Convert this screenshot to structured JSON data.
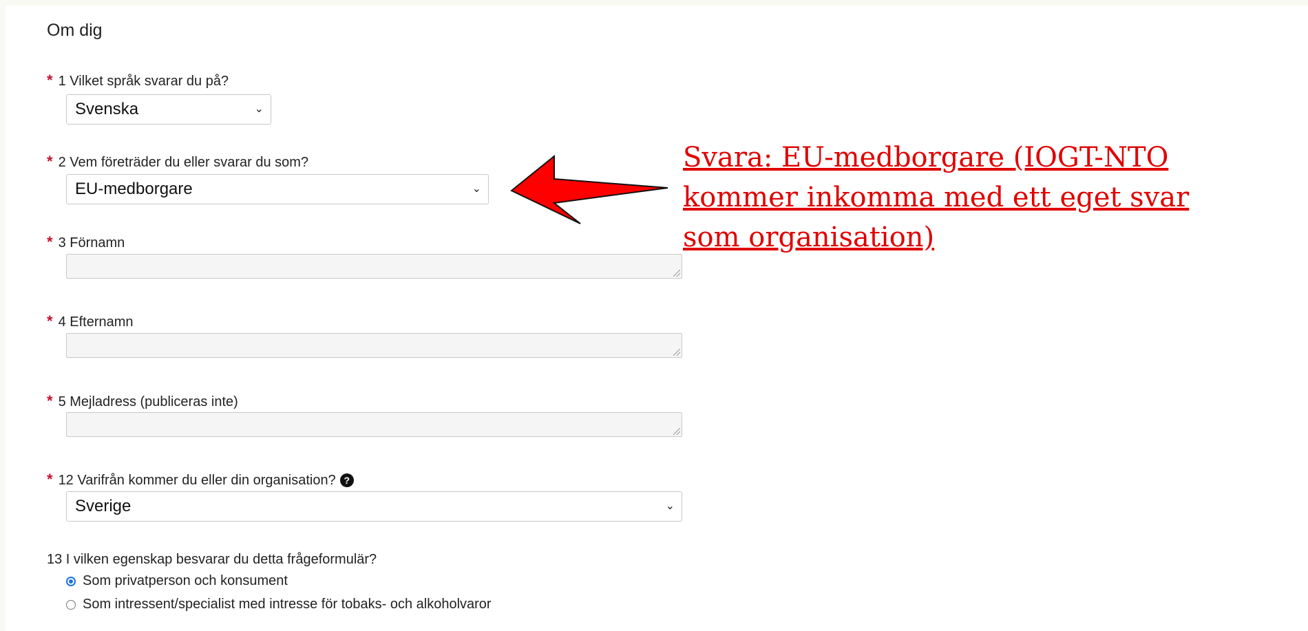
{
  "section": {
    "title": "Om dig"
  },
  "q1": {
    "required": "*",
    "label": "1 Vilket språk svarar du på?",
    "value": "Svenska"
  },
  "q2": {
    "required": "*",
    "label": "2 Vem företräder du eller svarar du som?",
    "value": "EU-medborgare"
  },
  "q3": {
    "required": "*",
    "label": "3 Förnamn",
    "value": ""
  },
  "q4": {
    "required": "*",
    "label": "4 Efternamn",
    "value": ""
  },
  "q5": {
    "required": "*",
    "label": "5 Mejladress (publiceras inte)",
    "value": ""
  },
  "q12": {
    "required": "*",
    "label": "12 Varifrån kommer du eller din organisation?",
    "help_icon": "question-circle-icon",
    "value": "Sverige"
  },
  "q13": {
    "label": "13 I vilken egenskap besvarar du detta frågeformulär?",
    "options": [
      {
        "label": "Som privatperson och konsument",
        "selected": true
      },
      {
        "label": "Som intressent/specialist med intresse för tobaks- och alkoholvaror",
        "selected": false
      }
    ]
  },
  "annotation": {
    "text": "Svara: EU-medborgare (IOGT-NTO kommer inkomma med ett eget svar som organisation)",
    "color": "#e00000",
    "arrow_color": "#ff0000"
  },
  "icons": {
    "select_chevron": "chevron-down-icon"
  }
}
